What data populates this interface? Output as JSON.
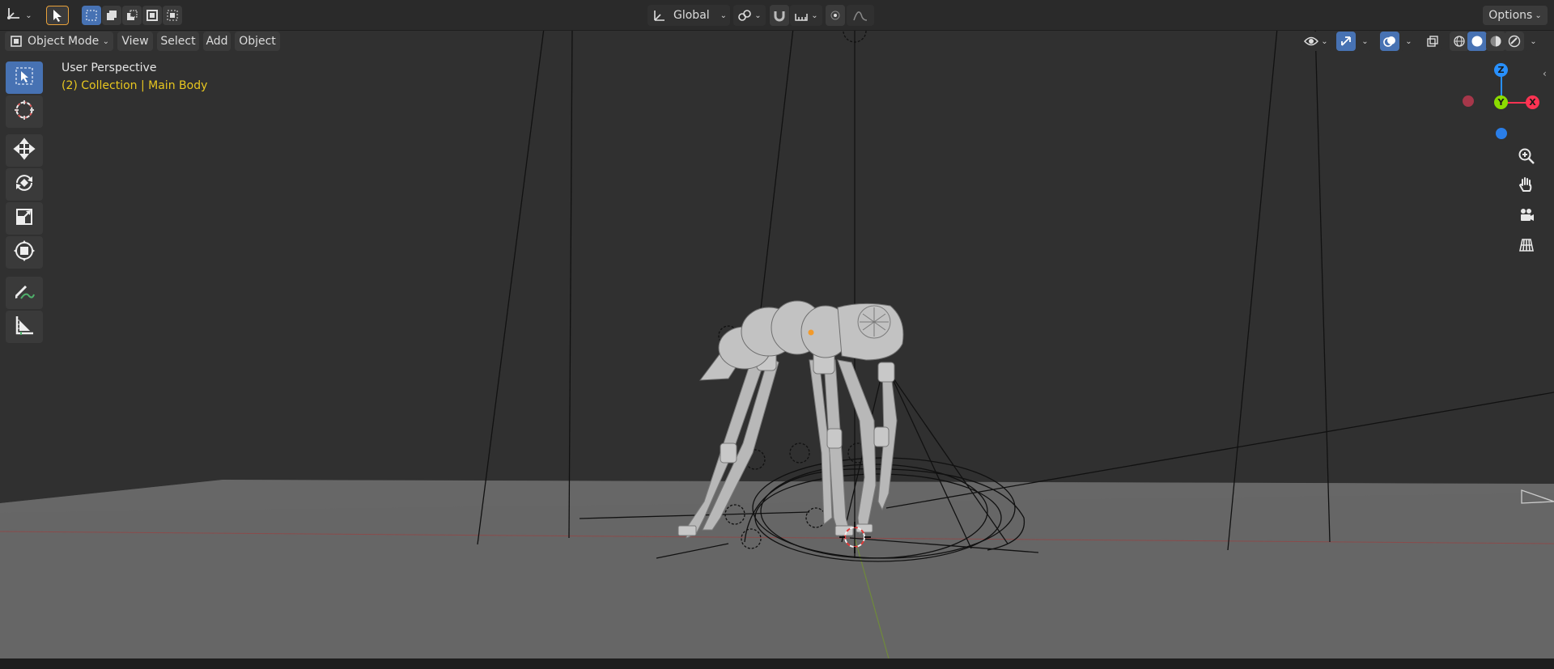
{
  "header": {
    "transform_orientation": "Global",
    "options_label": "Options"
  },
  "menubar": {
    "mode_label": "Object Mode",
    "items": [
      "View",
      "Select",
      "Add",
      "Object"
    ]
  },
  "overlay": {
    "view_name": "User Perspective",
    "collection_info": "(2) Collection | Main Body"
  },
  "gizmo": {
    "x_label": "X",
    "y_label": "Y",
    "z_label": "Z"
  },
  "icons": {
    "editor_type": "axes-grid-icon",
    "select_box": "cursor-arrow-icon",
    "cursor": "3d-cursor-icon",
    "move": "move-arrows-icon",
    "rotate": "rotate-icon",
    "scale": "scale-icon",
    "transform": "transform-icon",
    "annotate": "pencil-icon",
    "measure": "ruler-icon",
    "zoom": "zoom-in-icon",
    "pan": "hand-icon",
    "camera": "camera-icon",
    "ortho": "grid-icon"
  },
  "colors": {
    "active_blue": "#4772b3",
    "collection_text": "#e8c71f",
    "axis_x": "#ff3352",
    "axis_y": "#8bdc00",
    "axis_z": "#2890ff"
  }
}
